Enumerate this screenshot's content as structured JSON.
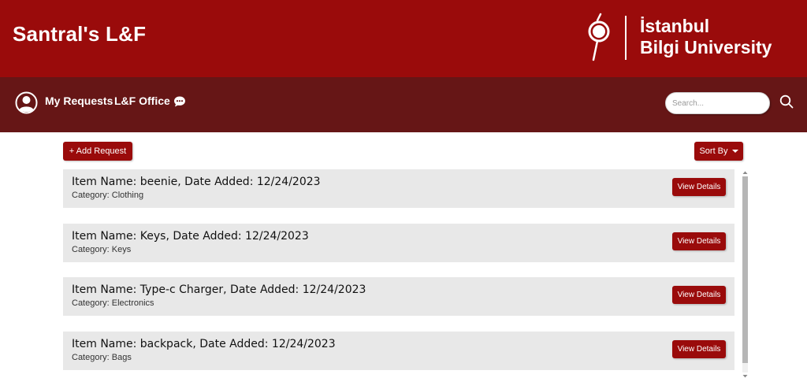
{
  "header": {
    "app_title": "Santral's L&F",
    "university_line1": "İstanbul",
    "university_line2": "Bilgi University"
  },
  "nav": {
    "my_requests": "My Requests",
    "lf_office": "L&F Office",
    "search_placeholder": "Search..."
  },
  "toolbar": {
    "add_request": "+ Add Request",
    "sort_by": "Sort By"
  },
  "items": [
    {
      "title": "Item Name: beenie, Date Added: 12/24/2023",
      "category": "Category: Clothing",
      "button": "View Details"
    },
    {
      "title": "Item Name: Keys, Date Added: 12/24/2023",
      "category": "Category: Keys",
      "button": "View Details"
    },
    {
      "title": "Item Name: Type-c Charger, Date Added: 12/24/2023",
      "category": "Category: Electronics",
      "button": "View Details"
    },
    {
      "title": "Item Name: backpack, Date Added: 12/24/2023",
      "category": "Category: Bags",
      "button": "View Details"
    }
  ],
  "colors": {
    "header_red": "#9a0b0b",
    "nav_dark_red": "#661616",
    "card_gray": "#e8e8e8"
  },
  "icons": [
    "user-icon",
    "chat-icon",
    "search-icon",
    "bilgi-logo-icon"
  ]
}
